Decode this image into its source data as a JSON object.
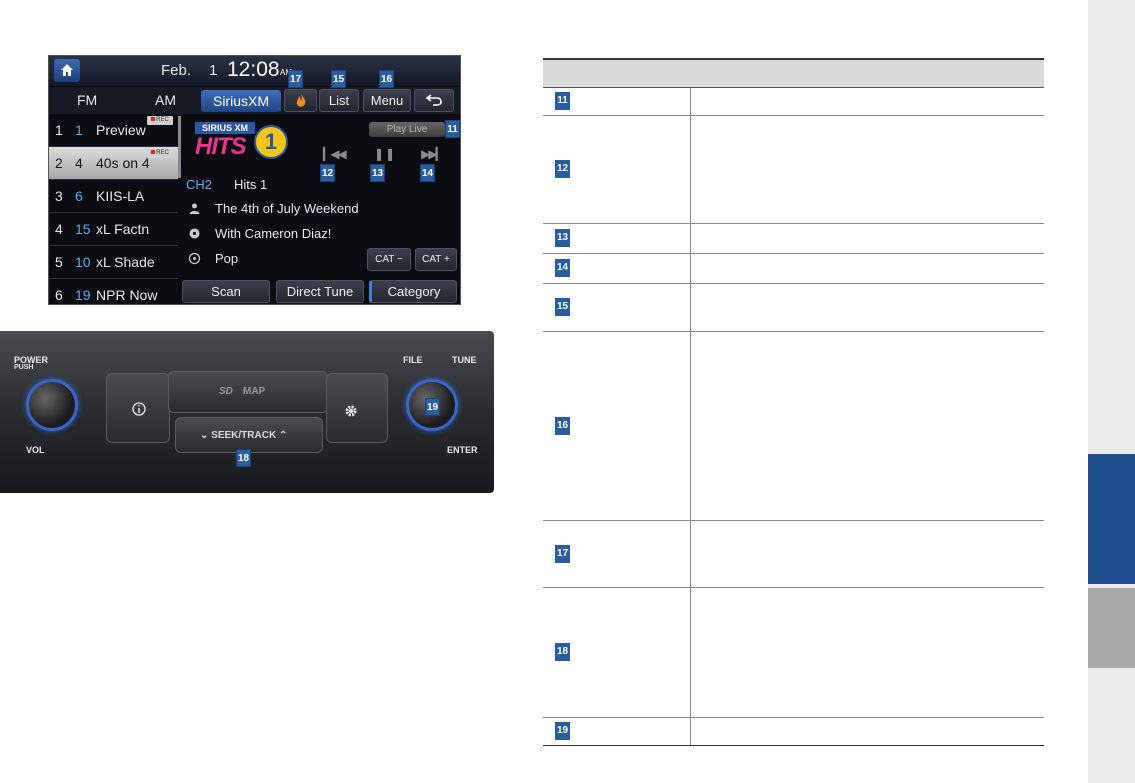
{
  "screen": {
    "date_month": "Feb.",
    "date_day": "1",
    "time": "12:08",
    "ampm": "AM",
    "bands": [
      "FM",
      "AM",
      "SiriusXM"
    ],
    "top_buttons": {
      "list": "List",
      "menu": "Menu"
    },
    "presets": [
      {
        "num": "1",
        "channel": "1",
        "label": "Preview",
        "rec": "REC"
      },
      {
        "num": "2",
        "channel": "4",
        "label": "40s on 4",
        "rec": "REC"
      },
      {
        "num": "3",
        "channel": "6",
        "label": "KIIS-LA"
      },
      {
        "num": "4",
        "channel": "15",
        "label": "xL Factn"
      },
      {
        "num": "5",
        "channel": "10",
        "label": "xL Shade"
      },
      {
        "num": "6",
        "channel": "19",
        "label": "NPR Now"
      }
    ],
    "logo": {
      "top": "SIRIUS XM",
      "hits": "HITS",
      "one": "1"
    },
    "play_live": "Play Live",
    "channel_no": "CH2",
    "channel_name": "Hits 1",
    "artist": "The 4th of July Weekend",
    "song": "With Cameron Diaz!",
    "category": "Pop",
    "cat_minus": "CAT −",
    "cat_plus": "CAT +",
    "bottom_buttons": {
      "scan": "Scan",
      "direct_tune": "Direct Tune",
      "category": "Category"
    }
  },
  "badges": {
    "b11": "11",
    "b12": "12",
    "b13": "13",
    "b14": "14",
    "b15": "15",
    "b16": "16",
    "b17": "17",
    "b18": "18",
    "b19": "19"
  },
  "panel": {
    "power": "POWER",
    "push": "PUSH",
    "vol": "VOL",
    "file": "FILE",
    "tune": "TUNE",
    "enter": "ENTER",
    "sd_map": "MAP",
    "seek_track": "SEEK/TRACK"
  },
  "table": {
    "headers": [
      "",
      ""
    ],
    "rows": [
      "11",
      "12",
      "13",
      "14",
      "15",
      "16",
      "17",
      "18",
      "19"
    ]
  },
  "colors": {
    "accent": "#2a5d9f",
    "side_tab_blue": "#1f4f8e",
    "side_tab_gray": "#a9a9a9"
  }
}
